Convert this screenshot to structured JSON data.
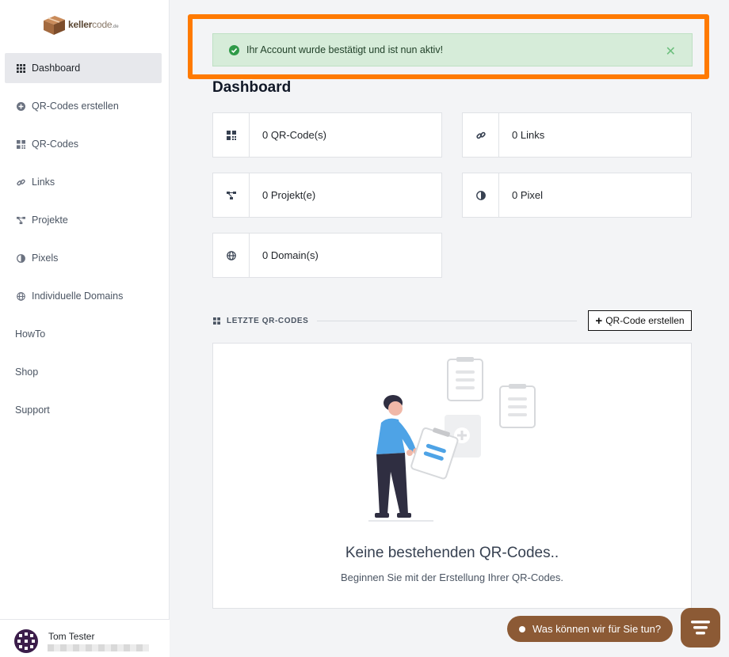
{
  "brand": {
    "name_bold": "keller",
    "name_light": "code",
    "tld": ".de"
  },
  "sidebar": {
    "items": [
      {
        "label": "Dashboard",
        "icon": "grid-icon"
      },
      {
        "label": "QR-Codes erstellen",
        "icon": "plus-circle-icon"
      },
      {
        "label": "QR-Codes",
        "icon": "qr-icon"
      },
      {
        "label": "Links",
        "icon": "link-icon"
      },
      {
        "label": "Projekte",
        "icon": "project-icon"
      },
      {
        "label": "Pixels",
        "icon": "contrast-icon"
      },
      {
        "label": "Individuelle Domains",
        "icon": "globe-icon"
      },
      {
        "label": "HowTo"
      },
      {
        "label": "Shop"
      },
      {
        "label": "Support"
      }
    ],
    "user_name": "Tom Tester"
  },
  "alert": {
    "message": "Ihr Account wurde bestätigt und ist nun aktiv!",
    "close": "✕"
  },
  "page_title": "Dashboard",
  "stats": {
    "qr": "0 QR-Code(s)",
    "links": "0 Links",
    "projects": "0 Projekt(e)",
    "pixel": "0 Pixel",
    "domains": "0 Domain(s)"
  },
  "recent": {
    "title": "LETZTE QR-CODES",
    "create_button": "QR-Code erstellen"
  },
  "empty_state": {
    "title": "Keine bestehenden QR-Codes..",
    "subtitle": "Beginnen Sie mit der Erstellung Ihrer QR-Codes."
  },
  "chat": {
    "label": "Was können wir für Sie tun?"
  },
  "colors": {
    "accent": "#ff7a00",
    "brand": "#8c5a35",
    "success_bg": "#d6ecd9"
  }
}
